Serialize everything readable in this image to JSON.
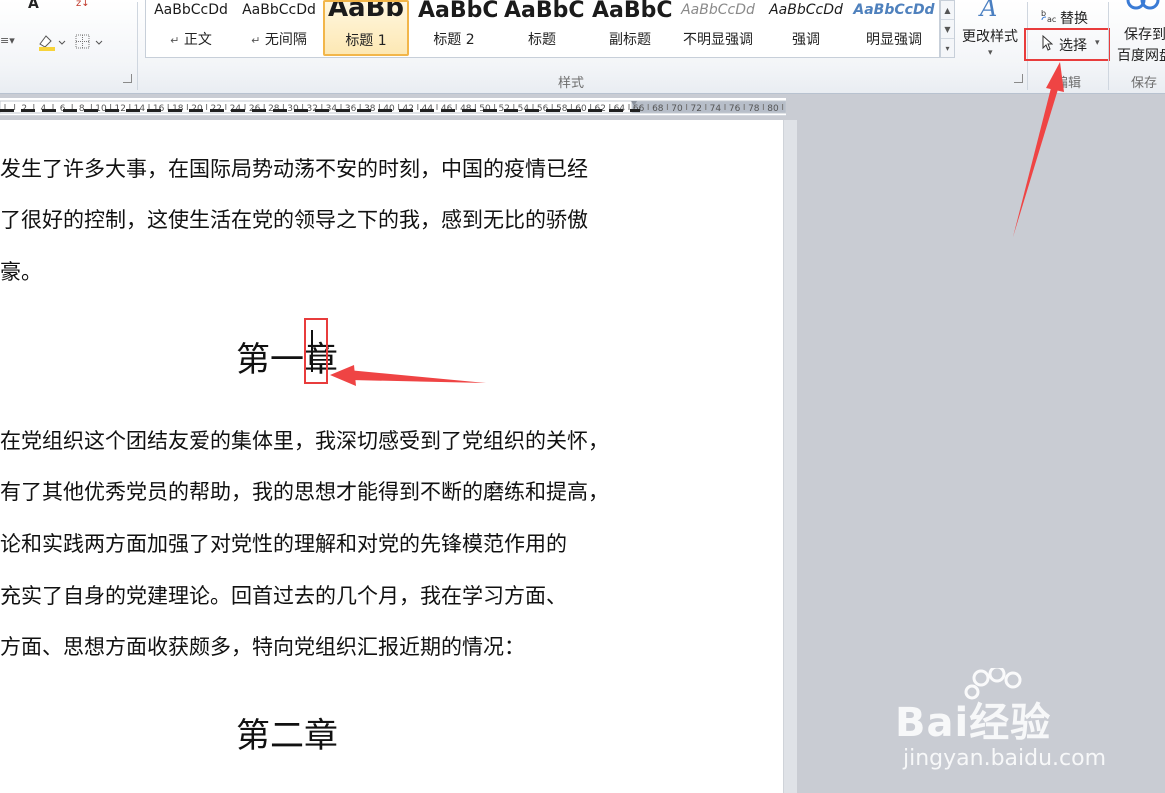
{
  "ribbon": {
    "styles": {
      "group_label": "样式",
      "items": [
        {
          "sample": "AaBbCcDd",
          "name": "正文",
          "prefix": "↵"
        },
        {
          "sample": "AaBbCcDd",
          "name": "无间隔",
          "prefix": "↵"
        },
        {
          "sample": "AaBb",
          "name": "标题 1",
          "selected": true
        },
        {
          "sample": "AaBbC",
          "name": "标题 2"
        },
        {
          "sample": "AaBbC",
          "name": "标题"
        },
        {
          "sample": "AaBbC",
          "name": "副标题"
        },
        {
          "sample": "AaBbCcDd",
          "name": "不明显强调"
        },
        {
          "sample": "AaBbCcDd",
          "name": "强调"
        },
        {
          "sample": "AaBbCcDd",
          "name": "明显强调"
        }
      ],
      "change_styles_label": "更改样式"
    },
    "editing": {
      "group_label": "编辑",
      "replace_label": "替换",
      "select_label": "选择"
    },
    "save": {
      "group_label": "保存",
      "line1": "保存到",
      "line2": "百度网盘"
    }
  },
  "document": {
    "paragraphs_top": [
      "发生了许多大事，在国际局势动荡不安的时刻，中国的疫情已经",
      "了很好的控制，这使生活在党的领导之下的我，感到无比的骄傲",
      "豪。"
    ],
    "heading1": "第一章",
    "paragraphs_mid": [
      "在党组织这个团结友爱的集体里，我深切感受到了党组织的关怀，",
      "有了其他优秀党员的帮助，我的思想才能得到不断的磨练和提高，",
      "论和实践两方面加强了对党性的理解和对党的先锋模范作用的",
      "  充实了自身的党建理论。回首过去的几个月，我在学习方面、",
      "方面、思想方面收获颇多，特向党组织汇报近期的情况："
    ],
    "heading2": "第二章"
  },
  "watermark": {
    "main": "Bai经验",
    "sub": "jingyan.baidu.com"
  },
  "colors": {
    "highlight": "#e83c3c",
    "selected_style_border": "#f2b64a"
  }
}
